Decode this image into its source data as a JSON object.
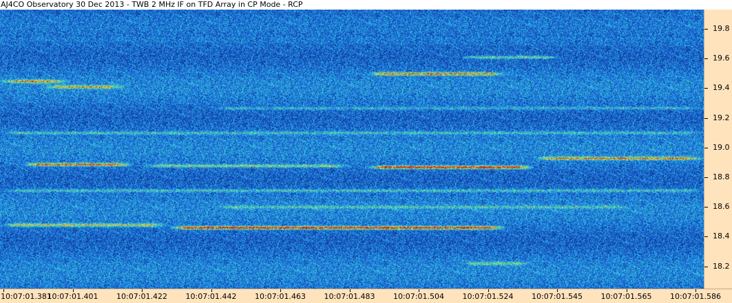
{
  "title": "AJ4CO Observatory 30 Dec 2013 - TWB 2 MHz IF on TFD Array in CP Mode - RCP",
  "chart_data": {
    "type": "heatmap",
    "title": "AJ4CO Observatory 30 Dec 2013 - TWB 2 MHz IF on TFD Array in CP Mode - RCP",
    "xlabel": "",
    "ylabel": "",
    "x_ticks": [
      "10:07:01.381",
      "10:07:01.401",
      "10:07:01.422",
      "10:07:01.442",
      "10:07:01.463",
      "10:07:01.483",
      "10:07:01.504",
      "10:07:01.524",
      "10:07:01.545",
      "10:07:01.565",
      "10:07:01.586"
    ],
    "y_ticks": [
      19.8,
      19.6,
      19.4,
      19.2,
      19.0,
      18.8,
      18.6,
      18.4,
      18.2
    ],
    "ylim": [
      18.05,
      19.93
    ],
    "colormap": [
      "#08205c",
      "#0b3fa8",
      "#1c64d2",
      "#2c8ee8",
      "#28c6e0",
      "#6fe08a",
      "#d8e040",
      "#e08030",
      "#c02020"
    ],
    "bands": [
      {
        "freq": 19.45,
        "t_start": 0.0,
        "t_end": 0.1,
        "intensity": 0.55
      },
      {
        "freq": 19.41,
        "t_start": 0.06,
        "t_end": 0.18,
        "intensity": 0.5
      },
      {
        "freq": 19.5,
        "t_start": 0.52,
        "t_end": 0.72,
        "intensity": 0.6
      },
      {
        "freq": 19.61,
        "t_start": 0.65,
        "t_end": 0.8,
        "intensity": 0.35
      },
      {
        "freq": 18.89,
        "t_start": 0.03,
        "t_end": 0.19,
        "intensity": 0.65
      },
      {
        "freq": 18.88,
        "t_start": 0.2,
        "t_end": 0.5,
        "intensity": 0.35
      },
      {
        "freq": 18.87,
        "t_start": 0.52,
        "t_end": 0.76,
        "intensity": 0.8
      },
      {
        "freq": 18.93,
        "t_start": 0.76,
        "t_end": 1.0,
        "intensity": 0.6
      },
      {
        "freq": 18.48,
        "t_start": 0.0,
        "t_end": 0.24,
        "intensity": 0.45
      },
      {
        "freq": 18.46,
        "t_start": 0.24,
        "t_end": 0.72,
        "intensity": 0.8
      },
      {
        "freq": 18.71,
        "t_start": 0.0,
        "t_end": 1.0,
        "intensity": 0.25
      },
      {
        "freq": 19.1,
        "t_start": 0.0,
        "t_end": 1.0,
        "intensity": 0.22
      },
      {
        "freq": 19.27,
        "t_start": 0.3,
        "t_end": 1.0,
        "intensity": 0.2
      },
      {
        "freq": 18.6,
        "t_start": 0.3,
        "t_end": 0.9,
        "intensity": 0.2
      },
      {
        "freq": 18.22,
        "t_start": 0.65,
        "t_end": 0.76,
        "intensity": 0.3
      }
    ]
  }
}
